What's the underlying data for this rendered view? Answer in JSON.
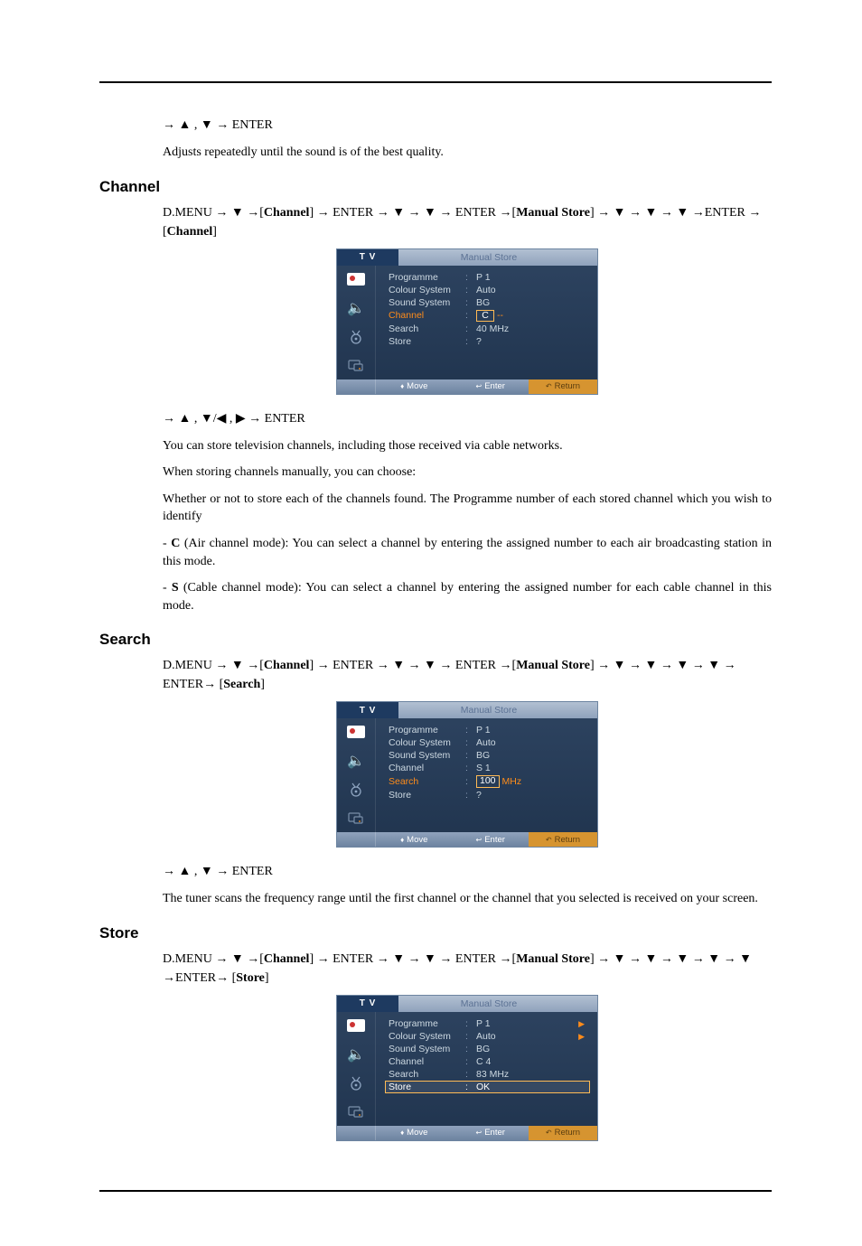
{
  "sections": {
    "s1": {
      "nav_step": "→ ▲ , ▼ → ENTER",
      "para": "Adjusts repeatedly until the sound is of the best quality."
    },
    "channel": {
      "heading": "Channel",
      "nav1": "D.MENU → ▼ →[",
      "nav1b": "Channel",
      "nav1c": "] → ENTER → ▼ → ▼ → ENTER →[",
      "nav1d": "Manual Store",
      "nav1e": "] → ▼ → ▼ → ▼ →ENTER → [",
      "nav1f": "Channel",
      "nav1g": "]",
      "nav_after": "→ ▲ , ▼/◀ , ▶ → ENTER",
      "p1": "You can store television channels, including those received via cable networks.",
      "p2": "When storing channels manually, you can choose:",
      "p3": "Whether or not to store each of the channels found. The Programme number of each stored channel which you wish to identify",
      "p4a": "- ",
      "p4b": "C",
      "p4c": " (Air channel mode): You can select a channel by entering the assigned number to each air broadcasting station in this mode.",
      "p5a": "- ",
      "p5b": "S",
      "p5c": " (Cable channel mode): You can select a channel by entering the assigned number for each cable channel in this mode."
    },
    "search": {
      "heading": "Search",
      "nav1": "D.MENU → ▼ →[",
      "nav1b": "Channel",
      "nav1c": "] → ENTER → ▼ → ▼ → ENTER →[",
      "nav1d": "Manual Store",
      "nav1e": "] → ▼ → ▼ → ▼ → ▼ → ENTER→ [",
      "nav1f": "Search",
      "nav1g": "]",
      "nav_after": "→ ▲ , ▼ → ENTER",
      "p1": "The tuner scans the frequency range until the first channel or the channel that you selected is received on your screen."
    },
    "store": {
      "heading": "Store",
      "nav1": "D.MENU → ▼ →[",
      "nav1b": "Channel",
      "nav1c": "] → ENTER → ▼ → ▼ → ENTER →[",
      "nav1d": "Manual Store",
      "nav1e": "] → ▼ → ▼ → ▼ → ▼ → ▼ →ENTER→ [",
      "nav1f": "Store",
      "nav1g": "]"
    }
  },
  "osd_common": {
    "tab": "T V",
    "title": "Manual Store",
    "labels": {
      "programme": "Programme",
      "colour": "Colour System",
      "sound": "Sound System",
      "channel": "Channel",
      "search": "Search",
      "store": "Store"
    },
    "footer": {
      "move": "Move",
      "enter": "Enter",
      "return": "Return"
    }
  },
  "osd1": {
    "programme": "P   1",
    "colour": "Auto",
    "sound": "BG",
    "channel_prefix": "C",
    "channel_suffix": "--",
    "search": "40   MHz",
    "store": "?"
  },
  "osd2": {
    "programme": "P   1",
    "colour": "Auto",
    "sound": "BG",
    "channel": "S   1",
    "search_val": "100",
    "search_unit": "MHz",
    "store": "?"
  },
  "osd3": {
    "programme": "P   1",
    "colour": "Auto",
    "sound": "BG",
    "channel": "C   4",
    "search": "83   MHz",
    "store": "OK"
  }
}
